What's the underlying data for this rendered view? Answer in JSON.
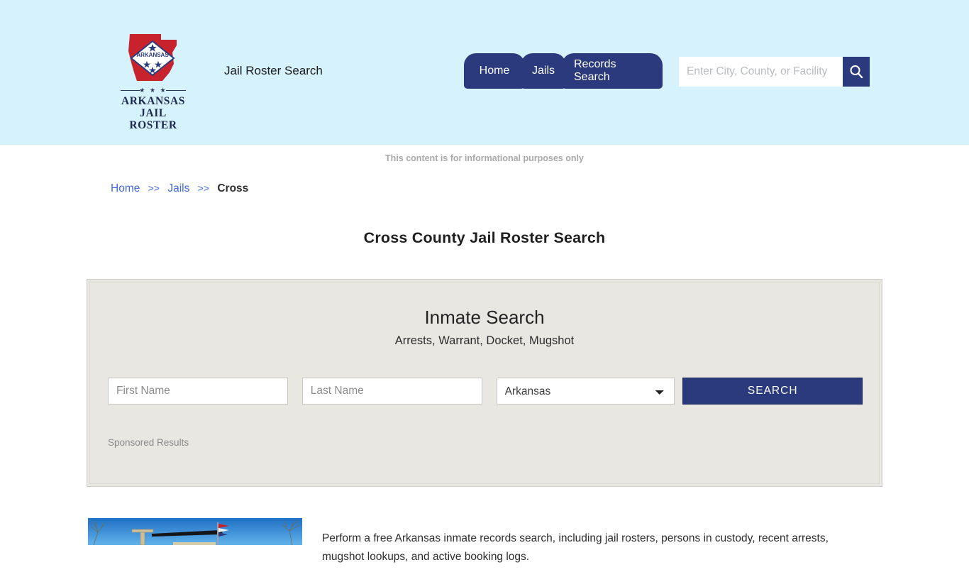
{
  "header": {
    "logo": {
      "state_label": "ARKANSAS",
      "brand_line1": "ARKANSAS",
      "brand_line2": "JAIL ROSTER",
      "divider_dots": "★ ★ ★"
    },
    "tagline": "Jail Roster Search",
    "nav": [
      {
        "label": "Home"
      },
      {
        "label": "Jails"
      },
      {
        "label": "Records Search"
      }
    ],
    "search": {
      "placeholder": "Enter City, County, or Facility",
      "value": "",
      "button_icon": "search-icon"
    },
    "background_color": "#d6f2fc"
  },
  "notice": "This content is for informational purposes only",
  "breadcrumb": {
    "items": [
      {
        "label": "Home",
        "link": true
      },
      {
        "label": "Jails",
        "link": true
      },
      {
        "label": "Cross",
        "link": false
      }
    ],
    "separator": ">>"
  },
  "page_title": "Cross County Jail Roster Search",
  "panel": {
    "title": "Inmate Search",
    "subtitle": "Arrests, Warrant, Docket, Mugshot",
    "first_name": {
      "placeholder": "First Name",
      "value": ""
    },
    "last_name": {
      "placeholder": "Last Name",
      "value": ""
    },
    "state_select": {
      "selected": "Arkansas",
      "options": [
        "Arkansas"
      ]
    },
    "search_button": "SEARCH",
    "sponsored_label": "Sponsored Results",
    "background_color": "#e9e7e2",
    "accent_color": "#2b3a7c"
  },
  "bottom": {
    "image_alt": "county-courthouse-photo",
    "paragraph": "Perform a free Arkansas inmate records search, including jail rosters, persons in custody, recent arrests, mugshot lookups, and active booking logs."
  }
}
